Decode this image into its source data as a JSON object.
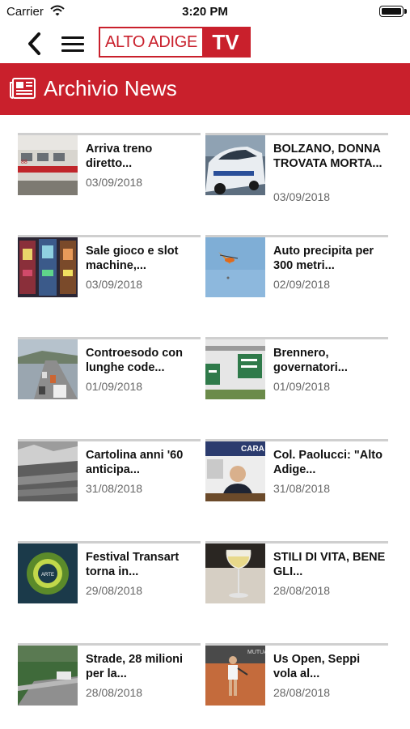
{
  "status_bar": {
    "carrier": "Carrier",
    "time": "3:20 PM"
  },
  "nav": {
    "logo_text": "ALTO ADIGE",
    "logo_tv": "TV"
  },
  "section": {
    "title": "Archivio News",
    "icon": "newspaper-icon"
  },
  "articles": [
    {
      "title": "Arriva treno diretto...",
      "date": "03/09/2018",
      "thumb": "train"
    },
    {
      "title": "BOLZANO, DONNA TROVATA MORTA...",
      "date": "03/09/2018",
      "thumb": "police-car"
    },
    {
      "title": "Sale gioco e slot machine,...",
      "date": "03/09/2018",
      "thumb": "slot-machines"
    },
    {
      "title": "Auto precipita per 300 metri...",
      "date": "02/09/2018",
      "thumb": "helicopter"
    },
    {
      "title": "Controesodo con lunghe code...",
      "date": "01/09/2018",
      "thumb": "highway-traffic"
    },
    {
      "title": "Brennero, governatori...",
      "date": "01/09/2018",
      "thumb": "road-signs"
    },
    {
      "title": "Cartolina anni '60 anticipa...",
      "date": "31/08/2018",
      "thumb": "town-postcard"
    },
    {
      "title": "Col. Paolucci: \"Alto Adige...",
      "date": "31/08/2018",
      "thumb": "officer"
    },
    {
      "title": "Festival Transart torna in...",
      "date": "29/08/2018",
      "thumb": "festival-logo"
    },
    {
      "title": "STILI DI VITA, BENE GLI...",
      "date": "28/08/2018",
      "thumb": "wine-glass"
    },
    {
      "title": "Strade, 28 milioni per la...",
      "date": "28/08/2018",
      "thumb": "road"
    },
    {
      "title": "Us Open, Seppi vola al...",
      "date": "28/08/2018",
      "thumb": "tennis-player"
    }
  ]
}
